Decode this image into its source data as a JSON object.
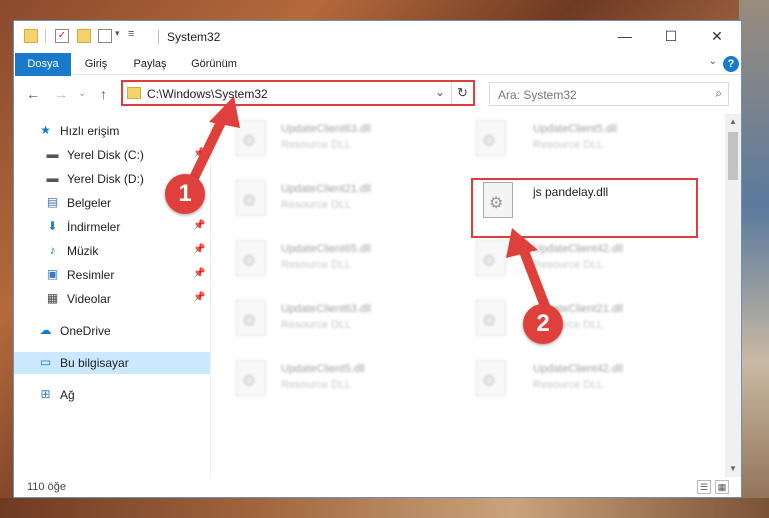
{
  "titlebar": {
    "title": "System32",
    "minimize": "—",
    "maximize": "☐",
    "close": "✕"
  },
  "ribbon": {
    "tabs": [
      "Dosya",
      "Giriş",
      "Paylaş",
      "Görünüm"
    ],
    "help": "?"
  },
  "nav": {
    "back": "←",
    "forward": "→",
    "up_dropdown": "⌄",
    "up": "↑",
    "address": "C:\\Windows\\System32",
    "address_dropdown": "⌄",
    "refresh": "↻",
    "search_placeholder": "Ara: System32",
    "search_icon": "⌕"
  },
  "sidebar": {
    "items": [
      {
        "label": "Hızlı erişim",
        "icon": "star-icon",
        "pinned": false
      },
      {
        "label": "Yerel Disk (C:)",
        "icon": "drive-icon",
        "pinned": true
      },
      {
        "label": "Yerel Disk (D:)",
        "icon": "drive-icon",
        "pinned": false
      },
      {
        "label": "Belgeler",
        "icon": "document-icon",
        "pinned": true
      },
      {
        "label": "İndirmeler",
        "icon": "download-icon",
        "pinned": true
      },
      {
        "label": "Müzik",
        "icon": "music-icon",
        "pinned": true
      },
      {
        "label": "Resimler",
        "icon": "pictures-icon",
        "pinned": true
      },
      {
        "label": "Videolar",
        "icon": "videos-icon",
        "pinned": true
      },
      {
        "label": "OneDrive",
        "icon": "cloud-icon",
        "pinned": false
      },
      {
        "label": "Bu bilgisayar",
        "icon": "computer-icon",
        "pinned": false,
        "selected": true
      },
      {
        "label": "Ağ",
        "icon": "network-icon",
        "pinned": false
      }
    ]
  },
  "files": {
    "left": [
      {
        "name": "UpdateClient63.dll",
        "type": "Resource DLL"
      },
      {
        "name": "UpdateClient21.dll",
        "type": "Resource DLL"
      },
      {
        "name": "UpdateClient65.dll",
        "type": "Resource DLL"
      },
      {
        "name": "UpdateClient63.dll",
        "type": "Resource DLL"
      },
      {
        "name": "UpdateClient5.dll",
        "type": "Resource DLL"
      }
    ],
    "right": [
      {
        "name": "UpdateClient5.dll",
        "type": "Resource DLL"
      },
      {
        "name": "js pandelay.dll",
        "type": ""
      },
      {
        "name": "UpdateClient42.dll",
        "type": "Resource DLL"
      },
      {
        "name": "UpdateClient21.dll",
        "type": "Resource DLL"
      },
      {
        "name": "UpdateClient42.dll",
        "type": "Resource DLL"
      }
    ]
  },
  "status": {
    "count": "110 öğe"
  },
  "annotations": {
    "badge1": "1",
    "badge2": "2",
    "color": "#e0403c"
  }
}
